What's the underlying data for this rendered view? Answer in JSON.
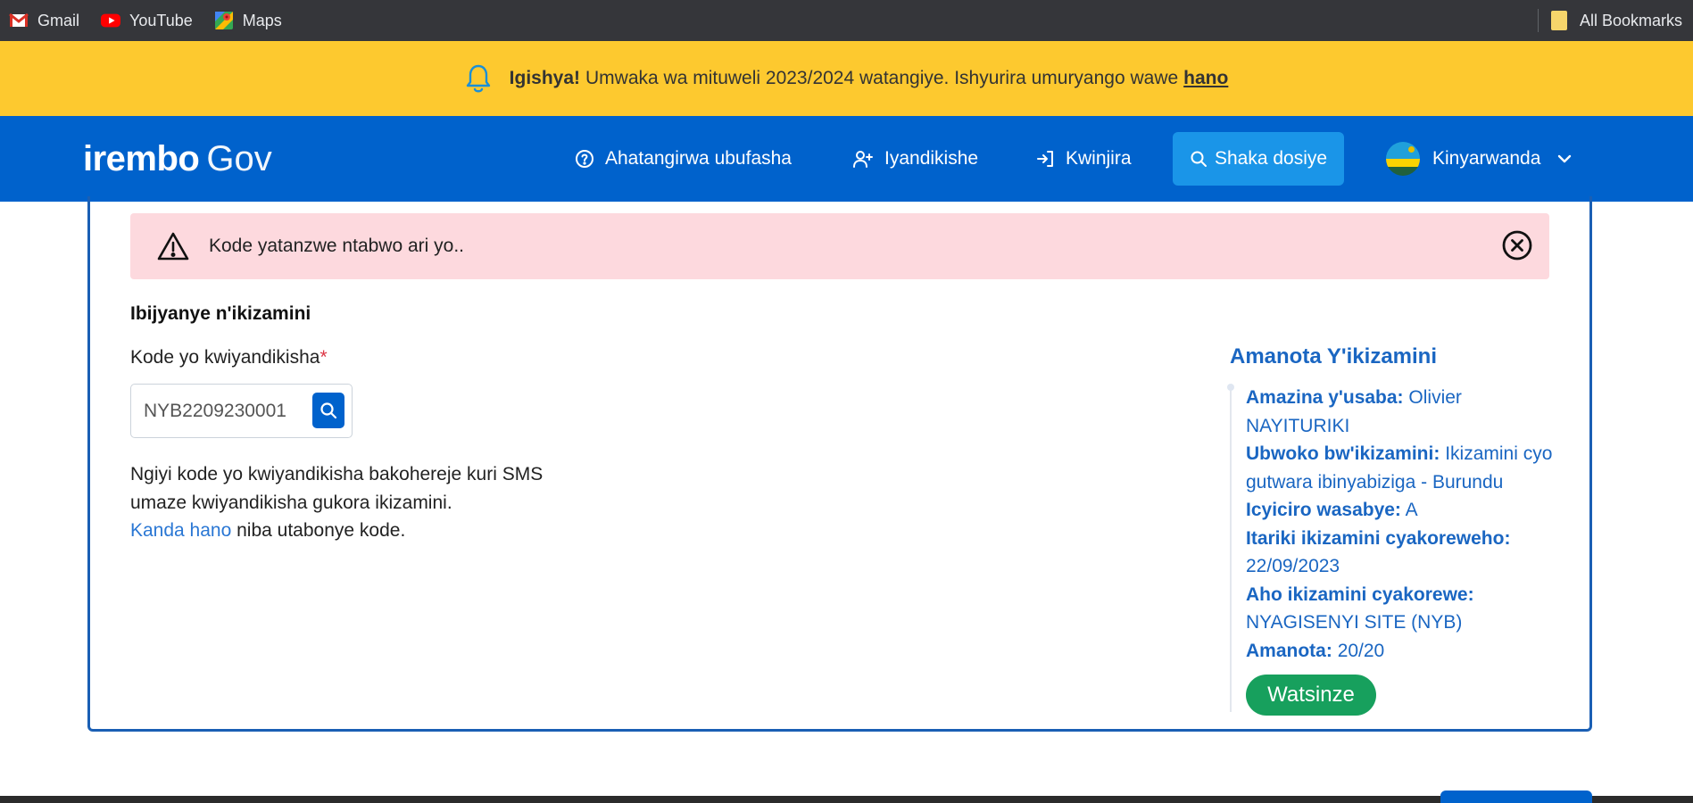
{
  "bookmarks": {
    "items": [
      {
        "label": "Gmail",
        "icon": "gmail-icon"
      },
      {
        "label": "YouTube",
        "icon": "youtube-icon"
      },
      {
        "label": "Maps",
        "icon": "maps-icon"
      }
    ],
    "all_bookmarks": "All Bookmarks"
  },
  "announcement": {
    "bold": "Igishya!",
    "text": "Umwaka wa mituweli 2023/2024 watangiye. Ishyurira umuryango wawe",
    "link": "hano",
    "bg_color": "#fdc92f"
  },
  "header": {
    "logo_brand": "irembo",
    "logo_gov": "Gov",
    "nav": {
      "help": "Ahatangirwa ubufasha",
      "register": "Iyandikishe",
      "login": "Kwinjira",
      "search": "Shaka dosiye",
      "language": "Kinyarwanda"
    },
    "bg_color": "#0062cc"
  },
  "alert": {
    "message": "Kode yatanzwe ntabwo ari yo.."
  },
  "form": {
    "section_title": "Ibijyanye n'ikizamini",
    "field_label": "Kode yo kwiyandikisha",
    "required_mark": "*",
    "field_value": "NYB2209230001",
    "help_line1": "Ngiyi kode yo kwiyandikisha bakohereje kuri SMS",
    "help_line2": "umaze kwiyandikisha gukora ikizamini.",
    "help_link": "Kanda hano",
    "help_line3": "niba utabonye kode."
  },
  "results": {
    "title": "Amanota Y'ikizamini",
    "rows": [
      {
        "label": "Amazina y'usaba:",
        "value": "Olivier NAYITURIKI"
      },
      {
        "label": "Ubwoko bw'ikizamini:",
        "value": "Ikizamini cyo gutwara ibinyabiziga - Burundu"
      },
      {
        "label": "Icyiciro wasabye:",
        "value": "A"
      },
      {
        "label": "Itariki ikizamini cyakoreweho:",
        "value": "22/09/2023"
      },
      {
        "label": "Aho ikizamini cyakorewe:",
        "value": "NYAGISENYI SITE (NYB)"
      },
      {
        "label": "Amanota:",
        "value": "20/20"
      }
    ],
    "status": "Watsinze",
    "status_color": "#17a05d"
  }
}
